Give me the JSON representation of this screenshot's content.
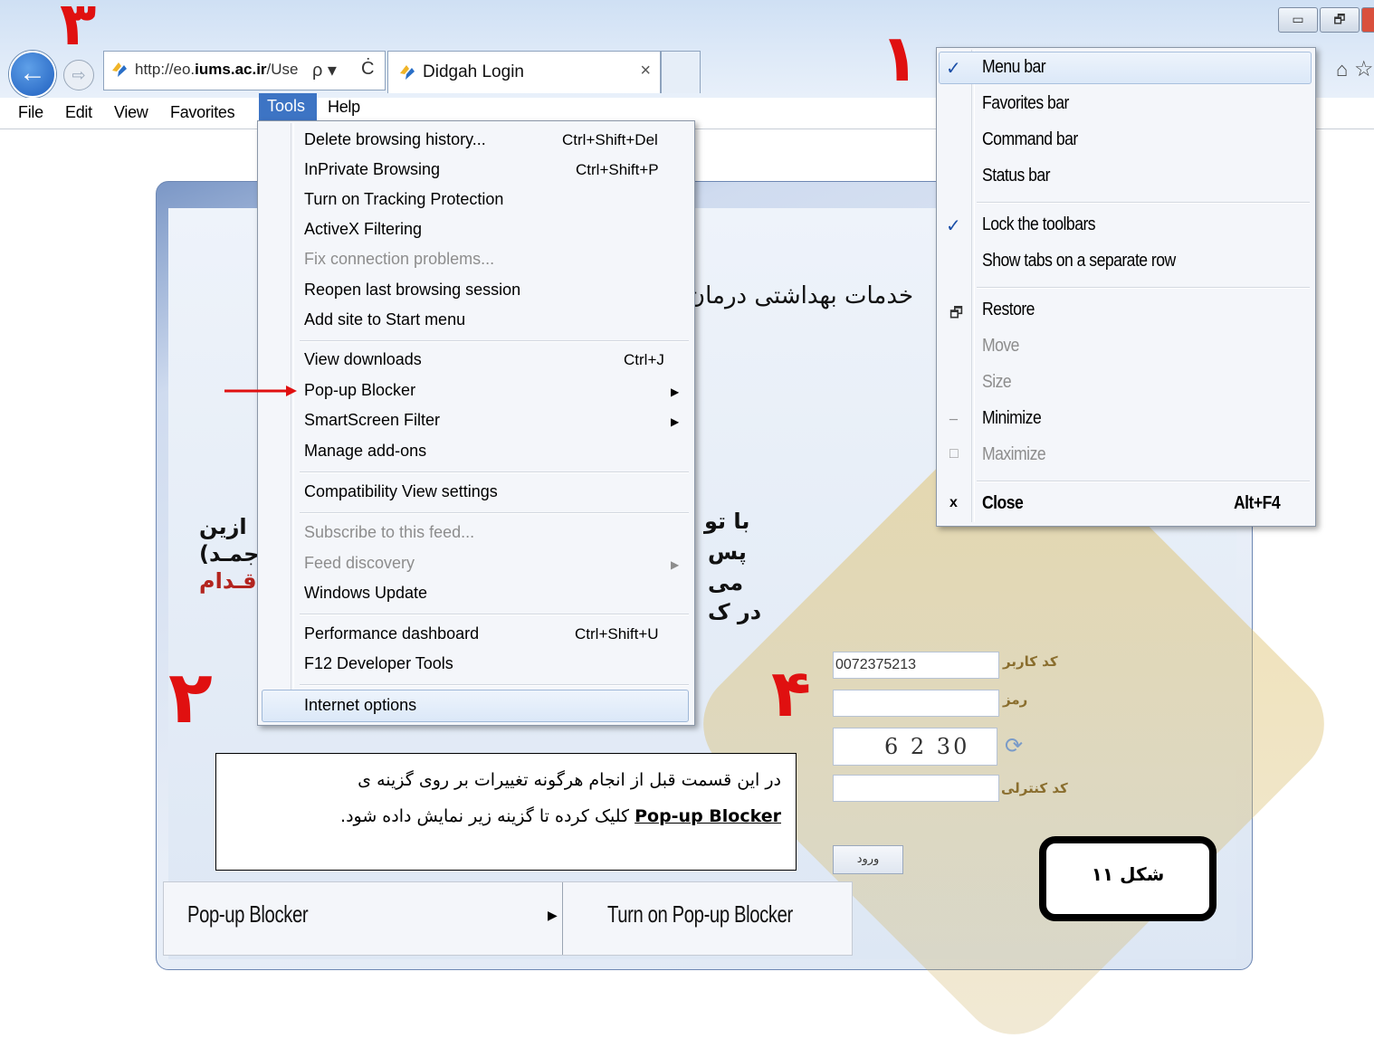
{
  "browser": {
    "address_url_prefix": "http://eo.",
    "address_url_domain": "iums.ac.ir",
    "address_url_suffix": "/Use",
    "address_icons": [
      "search-icon",
      "dropdown-icon",
      "refresh-icon"
    ],
    "tab_title": "Didgah Login",
    "tab_close": "×",
    "search_glyph": "ρ ▾",
    "refresh_glyph": "Ċ",
    "back_glyph": "←",
    "forward_glyph": "⇨",
    "window_buttons": [
      "▭",
      "🗗"
    ],
    "right_icons": [
      "home-icon",
      "star-icon"
    ]
  },
  "menubar": [
    "File",
    "Edit",
    "View",
    "Favorites",
    "Tools",
    "Help"
  ],
  "tools_menu": {
    "items": [
      {
        "label": "Delete browsing history...",
        "shortcut": "Ctrl+Shift+Del"
      },
      {
        "label": "InPrivate Browsing",
        "shortcut": "Ctrl+Shift+P"
      },
      {
        "label": "Turn on Tracking Protection"
      },
      {
        "label": "ActiveX Filtering"
      },
      {
        "label": "Fix connection problems..."
      },
      {
        "label": "Reopen last browsing session"
      },
      {
        "label": "Add site to Start menu"
      },
      {
        "label": "View downloads",
        "shortcut": "Ctrl+J"
      },
      {
        "label": "Pop-up Blocker"
      },
      {
        "label": "SmartScreen Filter"
      },
      {
        "label": "Manage add-ons"
      },
      {
        "label": "Compatibility View settings"
      },
      {
        "label": "Subscribe to this feed..."
      },
      {
        "label": "Feed discovery"
      },
      {
        "label": "Windows Update"
      },
      {
        "label": "Performance dashboard",
        "shortcut": "Ctrl+Shift+U"
      },
      {
        "label": "F12 Developer Tools"
      },
      {
        "label": "Internet options"
      }
    ],
    "submenu_arrow": "▶"
  },
  "context_menu": {
    "items": [
      {
        "label": "Menu bar",
        "checked": true
      },
      {
        "label": "Favorites bar"
      },
      {
        "label": "Command bar"
      },
      {
        "label": "Status bar"
      },
      {
        "label": "Lock the toolbars",
        "checked": true
      },
      {
        "label": "Show tabs on a separate row"
      },
      {
        "label": "Restore"
      },
      {
        "label": "Move"
      },
      {
        "label": "Size"
      },
      {
        "label": "Minimize"
      },
      {
        "label": "Maximize"
      },
      {
        "label": "Close",
        "shortcut": "Alt+F4"
      }
    ],
    "check_glyph": "✓",
    "restore_glyph": "🗗",
    "minimize_glyph": "_",
    "maximize_glyph": "□",
    "close_glyph": "x"
  },
  "annotations": {
    "n1": "۱",
    "n2": "۲",
    "n3": "۳",
    "n4": "۴",
    "red_arrow": "⟶"
  },
  "page": {
    "header_fragment": "خدمات بهداشتی درمان",
    "left_lines": [
      "ازین",
      "جمـد)",
      "اقـدام"
    ],
    "mid_lines": [
      "با تو",
      "پس",
      "می",
      "در ک"
    ],
    "login": {
      "username_label": "کد کاربر",
      "username_value": "0072375213",
      "password_label": "رمز",
      "captcha_label": "کد کنترلی",
      "captcha_text": "6 2 30",
      "submit_label": "ورود",
      "refresh_glyph": "⟳"
    }
  },
  "note": {
    "line1": "در این قسمت قبل از انجام هرگونه تغییرات بر روی گزینه ی",
    "line2_bold": "Pop-up Blocker",
    "line2_rest": " کلیک کرده  تا گزینه زیر نمایش داده شود."
  },
  "figure_label": "شکل ۱۱",
  "popup_strip": {
    "left": "Pop-up Blocker",
    "arrow": "▶",
    "right": "Turn on Pop-up Blocker"
  }
}
